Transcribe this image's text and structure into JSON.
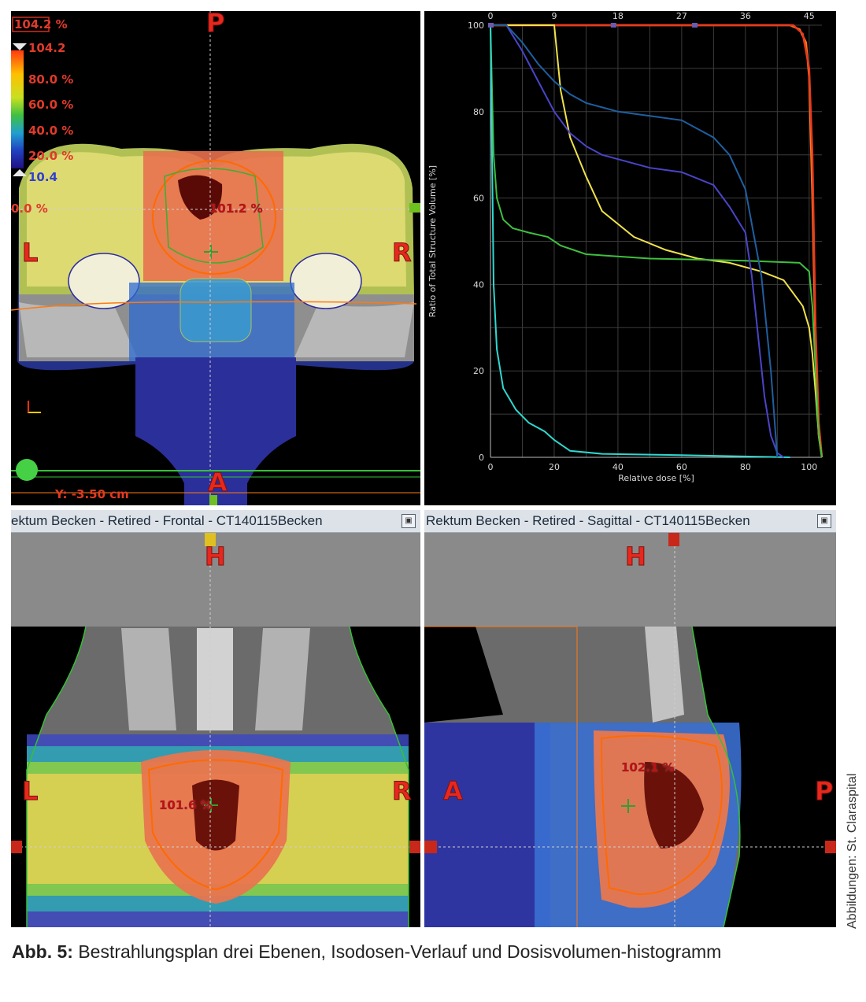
{
  "axial": {
    "legend": {
      "max_value": "104.2 %",
      "max_marker": "104.2",
      "levels": [
        "80.0 %",
        "60.0 %",
        "40.0 %",
        "20.0 %"
      ],
      "min_marker": "10.4",
      "cursor_value": "0.0 %"
    },
    "orientation": {
      "top": "P",
      "bottom": "A",
      "left": "L",
      "right": "R"
    },
    "dose_label": "101.2 %",
    "y_readout": "Y: -3.50 cm"
  },
  "dvh": {
    "title": "",
    "ylabel": "Ratio of Total Structure Volume [%]",
    "xlabel": "Relative dose [%]",
    "x_ticks": [
      "0",
      "20",
      "40",
      "60",
      "80",
      "100"
    ],
    "y_ticks": [
      "0",
      "20",
      "40",
      "60",
      "80",
      "100"
    ],
    "top_ticks": [
      "0",
      "9",
      "18",
      "27",
      "36",
      "45"
    ]
  },
  "chart_data": {
    "type": "line",
    "title": "",
    "xlabel": "Relative dose [%]",
    "ylabel": "Ratio of Total Structure Volume [%]",
    "xlim": [
      0,
      104
    ],
    "ylim": [
      0,
      100
    ],
    "top_axis_ticks": [
      0,
      9,
      18,
      27,
      36,
      45
    ],
    "grid": true,
    "series": [
      {
        "color": "#ff7a18",
        "x": [
          0,
          94,
          97,
          99,
          100,
          101,
          102,
          103,
          104
        ],
        "y": [
          100,
          100,
          99,
          96,
          88,
          60,
          25,
          5,
          0
        ]
      },
      {
        "color": "#e63a1e",
        "x": [
          0,
          95,
          98,
          100,
          101,
          102,
          103,
          104
        ],
        "y": [
          100,
          100,
          98,
          90,
          70,
          30,
          8,
          0
        ]
      },
      {
        "color": "#f0e24a",
        "x": [
          0,
          20,
          22,
          25,
          30,
          35,
          45,
          55,
          65,
          75,
          85,
          92,
          98,
          100,
          101,
          102,
          103,
          104
        ],
        "y": [
          100,
          100,
          85,
          74,
          65,
          57,
          51,
          48,
          46,
          45,
          43,
          41,
          35,
          30,
          24,
          15,
          5,
          0
        ]
      },
      {
        "color": "#3fbf3f",
        "x": [
          0,
          1,
          2,
          4,
          7,
          12,
          18,
          22,
          30,
          50,
          80,
          97,
          100,
          101,
          102,
          103,
          104
        ],
        "y": [
          100,
          70,
          60,
          55,
          53,
          52,
          51,
          49,
          47,
          46,
          45.5,
          45,
          43,
          35,
          20,
          5,
          0
        ]
      },
      {
        "color": "#2fd8d0",
        "x": [
          0,
          1,
          2,
          4,
          8,
          12,
          17,
          20,
          25,
          35,
          60,
          94
        ],
        "y": [
          100,
          40,
          25,
          16,
          11,
          8,
          6,
          4,
          1.5,
          0.8,
          0.5,
          0
        ]
      },
      {
        "color": "#4a45c8",
        "x": [
          0,
          5,
          10,
          15,
          20,
          25,
          30,
          35,
          40,
          50,
          60,
          70,
          75,
          80,
          82,
          84,
          86,
          88,
          90,
          92
        ],
        "y": [
          100,
          100,
          94,
          87,
          80,
          75,
          72,
          70,
          69,
          67,
          66,
          63,
          58,
          52,
          42,
          28,
          14,
          5,
          1,
          0
        ]
      },
      {
        "color": "#1f5fa0",
        "x": [
          0,
          5,
          10,
          15,
          20,
          25,
          30,
          40,
          50,
          60,
          70,
          75,
          80,
          85,
          88,
          90
        ],
        "y": [
          100,
          100,
          96,
          91,
          87,
          84,
          82,
          80,
          79,
          78,
          74,
          70,
          62,
          42,
          20,
          0
        ]
      }
    ]
  },
  "frontal": {
    "title": "ektum Becken  -  Retired - Frontal - CT140115Becken",
    "orientation": {
      "top": "H",
      "left": "L",
      "right": "R"
    },
    "dose_label": "101.6 %"
  },
  "sagittal": {
    "title": "Rektum Becken  -  Retired - Sagittal - CT140115Becken",
    "orientation": {
      "top": "H",
      "left": "A",
      "right": "P"
    },
    "dose_label": "102.1 %"
  },
  "caption": {
    "prefix": "Abb. 5:",
    "text": " Bestrahlungsplan drei Ebenen, Isodosen-Verlauf und Dosisvolumen-histogramm"
  },
  "credit": "Abbildungen: St. Claraspital",
  "window_button": "▣"
}
